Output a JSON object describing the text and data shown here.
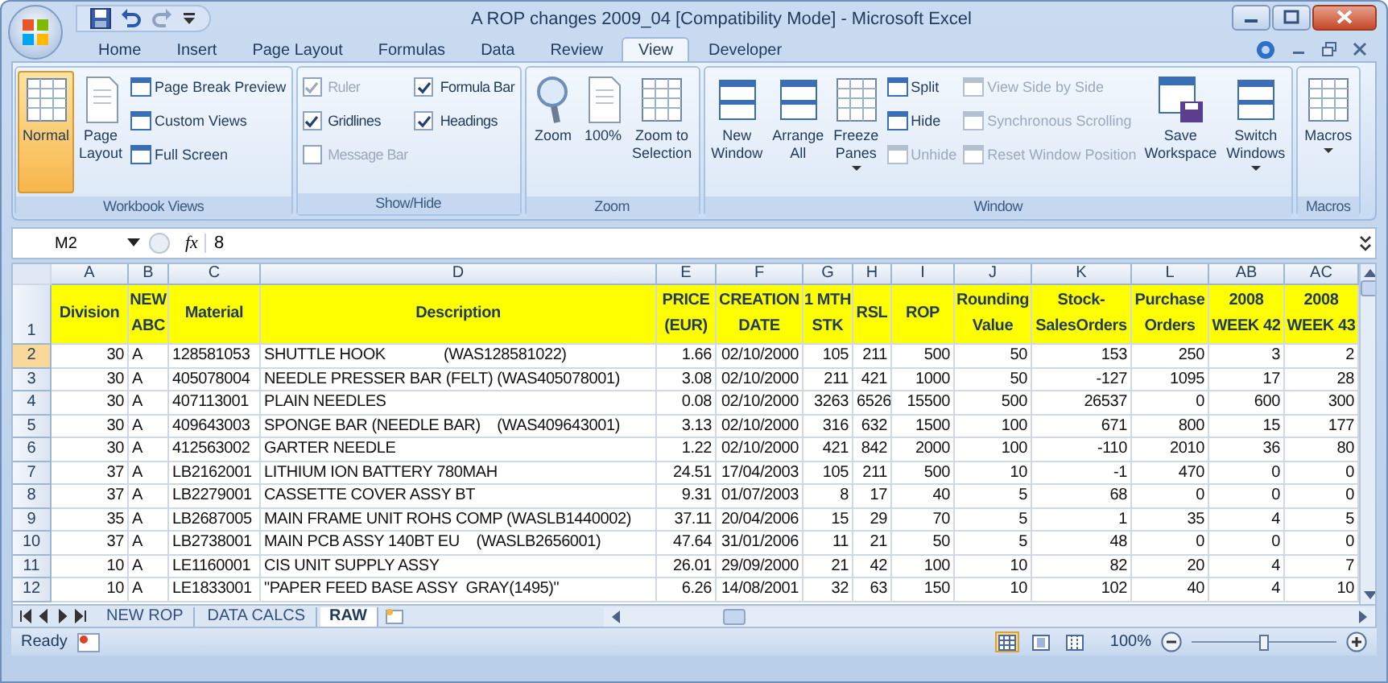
{
  "window": {
    "title": "A ROP changes 2009_04  [Compatibility Mode] - Microsoft Excel"
  },
  "tabs": [
    {
      "label": "Home",
      "selected": false
    },
    {
      "label": "Insert",
      "selected": false
    },
    {
      "label": "Page Layout",
      "selected": false
    },
    {
      "label": "Formulas",
      "selected": false
    },
    {
      "label": "Data",
      "selected": false
    },
    {
      "label": "Review",
      "selected": false
    },
    {
      "label": "View",
      "selected": true
    },
    {
      "label": "Developer",
      "selected": false
    }
  ],
  "ribbon": [
    {
      "label": "Workbook Views",
      "items": [
        {
          "kind": "large",
          "label": "Normal",
          "selected": true
        },
        {
          "kind": "large",
          "label": "Page Layout",
          "selected": false
        },
        {
          "kind": "small",
          "label": "Page Break Preview",
          "selected": false
        },
        {
          "kind": "small",
          "label": "Custom Views",
          "selected": false
        },
        {
          "kind": "small",
          "label": "Full Screen",
          "selected": false
        }
      ]
    },
    {
      "label": "Show/Hide",
      "items": [
        {
          "kind": "check",
          "label": "Ruler",
          "checked": true,
          "disabled": true
        },
        {
          "kind": "check",
          "label": "Gridlines",
          "checked": true,
          "disabled": false
        },
        {
          "kind": "check",
          "label": "Message Bar",
          "checked": false,
          "disabled": true
        },
        {
          "kind": "check",
          "label": "Formula Bar",
          "checked": true,
          "disabled": false
        },
        {
          "kind": "check",
          "label": "Headings",
          "checked": true,
          "disabled": false
        }
      ]
    },
    {
      "label": "Zoom",
      "items": [
        {
          "kind": "large",
          "label": "Zoom"
        },
        {
          "kind": "large",
          "label": "100%"
        },
        {
          "kind": "large",
          "label": "Zoom to Selection"
        }
      ]
    },
    {
      "label": "Window",
      "items": [
        {
          "kind": "large",
          "label": "New Window"
        },
        {
          "kind": "large",
          "label": "Arrange All"
        },
        {
          "kind": "large",
          "label": "Freeze Panes",
          "dropdown": true
        },
        {
          "kind": "small",
          "label": "Split",
          "disabled": false
        },
        {
          "kind": "small",
          "label": "Hide",
          "disabled": false
        },
        {
          "kind": "small",
          "label": "Unhide",
          "disabled": true
        },
        {
          "kind": "small",
          "label": "View Side by Side",
          "disabled": true
        },
        {
          "kind": "small",
          "label": "Synchronous Scrolling",
          "disabled": true
        },
        {
          "kind": "small",
          "label": "Reset Window Position",
          "disabled": true
        },
        {
          "kind": "large",
          "label": "Save Workspace"
        },
        {
          "kind": "large",
          "label": "Switch Windows",
          "dropdown": true
        }
      ]
    },
    {
      "label": "Macros",
      "items": [
        {
          "kind": "large",
          "label": "Macros",
          "dropdown": true
        }
      ]
    }
  ],
  "formula_bar": {
    "name_box": "M2",
    "fx_label": "fx",
    "formula": "8"
  },
  "sheet": {
    "header_row": "1",
    "columns": [
      {
        "letter": "A",
        "heading": [
          "Division"
        ],
        "kind": "number"
      },
      {
        "letter": "B",
        "heading": [
          "NEW",
          "ABC"
        ],
        "kind": "text"
      },
      {
        "letter": "C",
        "heading": [
          "Material"
        ],
        "kind": "text"
      },
      {
        "letter": "D",
        "heading": [
          "Description"
        ],
        "kind": "text"
      },
      {
        "letter": "E",
        "heading": [
          "PRICE",
          "(EUR)"
        ],
        "kind": "number"
      },
      {
        "letter": "F",
        "heading": [
          "CREATION",
          "DATE"
        ],
        "kind": "number"
      },
      {
        "letter": "G",
        "heading": [
          "1 MTH",
          "STK"
        ],
        "kind": "number"
      },
      {
        "letter": "H",
        "heading": [
          "RSL"
        ],
        "kind": "number"
      },
      {
        "letter": "I",
        "heading": [
          "ROP"
        ],
        "kind": "number"
      },
      {
        "letter": "J",
        "heading": [
          "Rounding",
          "Value"
        ],
        "kind": "number"
      },
      {
        "letter": "K",
        "heading": [
          "Stock-",
          "SalesOrders"
        ],
        "kind": "number"
      },
      {
        "letter": "L",
        "heading": [
          "Purchase",
          "Orders"
        ],
        "kind": "number"
      },
      {
        "letter": "AB",
        "heading": [
          "2008",
          "WEEK 42"
        ],
        "kind": "number"
      },
      {
        "letter": "AC",
        "heading": [
          "2008",
          "WEEK 43"
        ],
        "kind": "number"
      }
    ],
    "rows": [
      {
        "number": "2",
        "selected": true,
        "cells": [
          "30",
          "A",
          "128581053",
          "SHUTTLE HOOK              (WAS128581022)",
          "1.66",
          "02/10/2000",
          "105",
          "211",
          "500",
          "50",
          "153",
          "250",
          "3",
          "2"
        ]
      },
      {
        "number": "3",
        "selected": false,
        "cells": [
          "30",
          "A",
          "405078004",
          "NEEDLE PRESSER BAR (FELT) (WAS405078001)",
          "3.08",
          "02/10/2000",
          "211",
          "421",
          "1000",
          "50",
          "-127",
          "1095",
          "17",
          "28"
        ]
      },
      {
        "number": "4",
        "selected": false,
        "cells": [
          "30",
          "A",
          "407113001",
          "PLAIN NEEDLES",
          "0.08",
          "02/10/2000",
          "3263",
          "6526",
          "15500",
          "500",
          "26537",
          "0",
          "600",
          "300"
        ]
      },
      {
        "number": "5",
        "selected": false,
        "cells": [
          "30",
          "A",
          "409643003",
          "SPONGE BAR (NEEDLE BAR)    (WAS409643001)",
          "3.13",
          "02/10/2000",
          "316",
          "632",
          "1500",
          "100",
          "671",
          "800",
          "15",
          "177"
        ]
      },
      {
        "number": "6",
        "selected": false,
        "cells": [
          "30",
          "A",
          "412563002",
          "GARTER NEEDLE",
          "1.22",
          "02/10/2000",
          "421",
          "842",
          "2000",
          "100",
          "-110",
          "2010",
          "36",
          "80"
        ]
      },
      {
        "number": "7",
        "selected": false,
        "cells": [
          "37",
          "A",
          "LB2162001",
          "LITHIUM ION BATTERY 780MAH",
          "24.51",
          "17/04/2003",
          "105",
          "211",
          "500",
          "10",
          "-1",
          "470",
          "0",
          "0"
        ]
      },
      {
        "number": "8",
        "selected": false,
        "cells": [
          "37",
          "A",
          "LB2279001",
          "CASSETTE COVER ASSY BT",
          "9.31",
          "01/07/2003",
          "8",
          "17",
          "40",
          "5",
          "68",
          "0",
          "0",
          "0"
        ]
      },
      {
        "number": "9",
        "selected": false,
        "cells": [
          "35",
          "A",
          "LB2687005",
          "MAIN FRAME UNIT ROHS COMP (WASLB1440002)",
          "37.11",
          "20/04/2006",
          "15",
          "29",
          "70",
          "5",
          "1",
          "35",
          "4",
          "5"
        ]
      },
      {
        "number": "10",
        "selected": false,
        "cells": [
          "37",
          "A",
          "LB2738001",
          "MAIN PCB ASSY 140BT EU    (WASLB2656001)",
          "47.64",
          "31/01/2006",
          "11",
          "21",
          "50",
          "5",
          "48",
          "0",
          "0",
          "0"
        ]
      },
      {
        "number": "11",
        "selected": false,
        "cells": [
          "10",
          "A",
          "LE1160001",
          "CIS UNIT SUPPLY ASSY",
          "26.01",
          "29/09/2000",
          "21",
          "42",
          "100",
          "10",
          "82",
          "20",
          "4",
          "7"
        ]
      },
      {
        "number": "12",
        "selected": false,
        "cells": [
          "10",
          "A",
          "LE1833001",
          "\"PAPER FEED BASE ASSY  GRAY(1495)\"",
          "6.26",
          "14/08/2001",
          "32",
          "63",
          "150",
          "10",
          "102",
          "40",
          "4",
          "10"
        ]
      }
    ]
  },
  "sheet_tabs": [
    {
      "label": "NEW ROP",
      "selected": false
    },
    {
      "label": "DATA CALCS",
      "selected": false
    },
    {
      "label": "RAW",
      "selected": true
    }
  ],
  "status_bar": {
    "mode": "Ready",
    "page_views": [
      {
        "selected": true
      },
      {
        "selected": false
      },
      {
        "selected": false
      }
    ],
    "zoom_label": "100%",
    "zoom_slider": {
      "level": 0.5
    }
  }
}
